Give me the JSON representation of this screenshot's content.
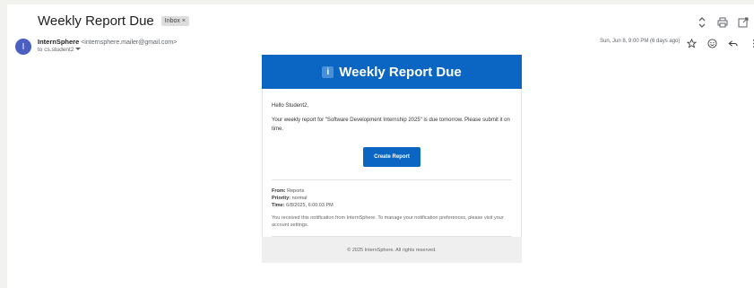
{
  "email": {
    "subject": "Weekly Report Due",
    "label": "Inbox",
    "label_close": "×",
    "avatar_letter": "I",
    "sender_name": "InternSphere",
    "sender_email": "<internsphere.mailer@gmail.com>",
    "to": "to cs.student2",
    "date": "Sun, Jun 8, 9:00 PM (6 days ago)"
  },
  "icons": {
    "top": [
      "expand-icon",
      "print-icon",
      "open-new-window-icon"
    ],
    "message": [
      "star-icon",
      "emoji-icon",
      "reply-icon",
      "more-vertical-icon"
    ]
  },
  "content": {
    "header_glyph": "i",
    "title": "Weekly Report Due",
    "greeting": "Hello Student2,",
    "message": "Your weekly report for \"Software Development Internship 2025\" is due tomorrow. Please submit it on time.",
    "cta_label": "Create Report",
    "from_label": "From:",
    "from_value": "Reports",
    "priority_label": "Priority:",
    "priority_value": "normal",
    "time_label": "Time:",
    "time_value": "6/8/2025, 6:00:03 PM",
    "notice": "You received this notification from InternSphere. To manage your notification preferences, please visit your account settings.",
    "footer": "© 2025 InternSphere. All rights reserved."
  },
  "colors": {
    "accent": "#0a66c2",
    "avatar": "#4a5fc1"
  }
}
